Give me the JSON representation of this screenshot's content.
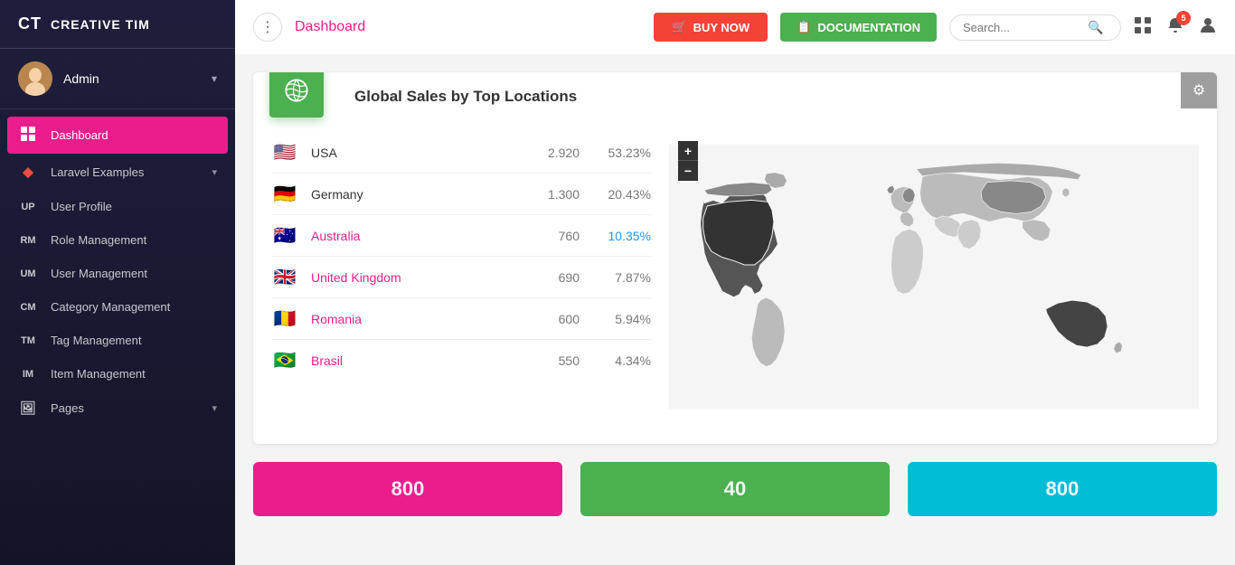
{
  "sidebar": {
    "logo_initials": "CT",
    "logo_name": "CREATIVE TIM",
    "user": {
      "name": "Admin",
      "avatar_text": "👤"
    },
    "nav_items": [
      {
        "id": "dashboard",
        "icon": "⊞",
        "icon_text": "▪▪",
        "label": "Dashboard",
        "active": true,
        "has_arrow": false
      },
      {
        "id": "laravel-examples",
        "icon": "◆",
        "label": "Laravel Examples",
        "active": false,
        "has_arrow": true
      },
      {
        "id": "user-profile",
        "icon_text": "UP",
        "label": "User Profile",
        "active": false,
        "has_arrow": false
      },
      {
        "id": "role-management",
        "icon_text": "RM",
        "label": "Role Management",
        "active": false,
        "has_arrow": false
      },
      {
        "id": "user-management",
        "icon_text": "UM",
        "label": "User Management",
        "active": false,
        "has_arrow": false
      },
      {
        "id": "category-management",
        "icon_text": "CM",
        "label": "Category Management",
        "active": false,
        "has_arrow": false
      },
      {
        "id": "tag-management",
        "icon_text": "TM",
        "label": "Tag Management",
        "active": false,
        "has_arrow": false
      },
      {
        "id": "item-management",
        "icon_text": "IM",
        "label": "Item Management",
        "active": false,
        "has_arrow": false
      },
      {
        "id": "pages",
        "icon_text": "🖼",
        "label": "Pages",
        "active": false,
        "has_arrow": true
      }
    ]
  },
  "header": {
    "menu_icon": "⋮",
    "title": "Dashboard",
    "buy_now_label": "BUY NOW",
    "documentation_label": "DOCUMENTATION",
    "search_placeholder": "Search...",
    "notification_count": "5"
  },
  "map_section": {
    "title_start": "Global Sales by ",
    "title_bold": "Top Locations",
    "locations": [
      {
        "flag": "🇺🇸",
        "name": "USA",
        "count": "2.920",
        "pct": "53.23%",
        "name_style": "dark",
        "pct_style": "normal"
      },
      {
        "flag": "🇩🇪",
        "name": "Germany",
        "count": "1.300",
        "pct": "20.43%",
        "name_style": "dark",
        "pct_style": "normal"
      },
      {
        "flag": "🇦🇺",
        "name": "Australia",
        "count": "760",
        "pct": "10.35%",
        "name_style": "link",
        "pct_style": "blue"
      },
      {
        "flag": "🇬🇧",
        "name": "United Kingdom",
        "count": "690",
        "pct": "7.87%",
        "name_style": "link",
        "pct_style": "normal"
      },
      {
        "flag": "🇷🇴",
        "name": "Romania",
        "count": "600",
        "pct": "5.94%",
        "name_style": "link",
        "pct_style": "normal"
      },
      {
        "flag": "🇧🇷",
        "name": "Brasil",
        "count": "550",
        "pct": "4.34%",
        "name_style": "link",
        "pct_style": "normal"
      }
    ],
    "zoom_plus": "+",
    "zoom_minus": "−"
  },
  "bottom_cards": [
    {
      "value": "800",
      "color": "pink"
    },
    {
      "value": "40",
      "color": "green"
    },
    {
      "value": "800",
      "color": "cyan"
    }
  ]
}
